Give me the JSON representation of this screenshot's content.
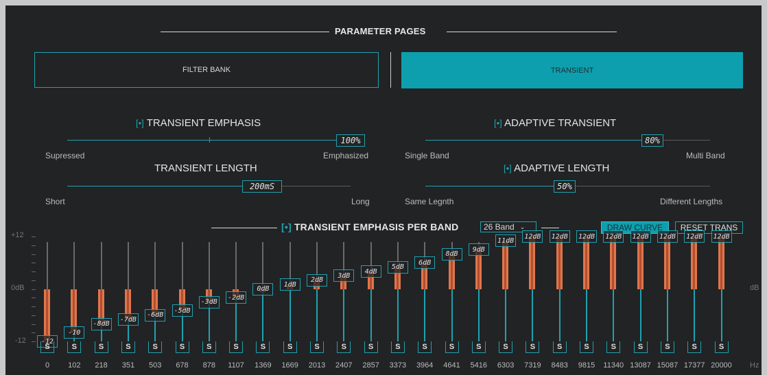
{
  "header": {
    "title": "PARAMETER PAGES"
  },
  "pages": {
    "filter_bank": "FILTER BANK",
    "transient": "TRANSIENT"
  },
  "transient_emphasis": {
    "toggle": "[•]",
    "title": "TRANSIENT EMPHASIS",
    "value": "100%",
    "level": 1.0,
    "min_label": "Supressed",
    "max_label": "Emphasized"
  },
  "transient_length": {
    "title": "TRANSIENT LENGTH",
    "value": "200mS",
    "level": 0.6,
    "min_label": "Short",
    "max_label": "Long"
  },
  "adaptive_transient": {
    "toggle": "[•]",
    "title": "ADAPTIVE TRANSIENT",
    "value": "80%",
    "level": 0.8,
    "min_label": "Single Band",
    "max_label": "Multi Band"
  },
  "adaptive_length": {
    "toggle": "[•]",
    "title": "ADAPTIVE LENGTH",
    "value": "50%",
    "level": 0.5,
    "min_label": "Same Legnth",
    "max_label": "Different Lengths"
  },
  "per_band": {
    "toggle": "[•]",
    "title": "TRANSIENT EMPHASIS PER BAND",
    "band_select": "26 Band",
    "draw_curve": "DRAW CURVE",
    "reset_trans": "RESET TRANS",
    "y_top": "+12",
    "y_mid": "0dB",
    "y_bottom": "-12",
    "unit_right": "dB",
    "hz": "Hz",
    "solo": "S",
    "bands": [
      {
        "freq": "0",
        "label": "-12",
        "db": -12
      },
      {
        "freq": "102",
        "label": "-10",
        "db": -10
      },
      {
        "freq": "218",
        "label": "-8dB",
        "db": -8
      },
      {
        "freq": "351",
        "label": "-7dB",
        "db": -7
      },
      {
        "freq": "503",
        "label": "-6dB",
        "db": -6
      },
      {
        "freq": "678",
        "label": "-5dB",
        "db": -5
      },
      {
        "freq": "878",
        "label": "-3dB",
        "db": -3
      },
      {
        "freq": "1107",
        "label": "-2dB",
        "db": -2
      },
      {
        "freq": "1369",
        "label": "0dB",
        "db": 0
      },
      {
        "freq": "1669",
        "label": "1dB",
        "db": 1
      },
      {
        "freq": "2013",
        "label": "2dB",
        "db": 2
      },
      {
        "freq": "2407",
        "label": "3dB",
        "db": 3
      },
      {
        "freq": "2857",
        "label": "4dB",
        "db": 4
      },
      {
        "freq": "3373",
        "label": "5dB",
        "db": 5
      },
      {
        "freq": "3964",
        "label": "6dB",
        "db": 6
      },
      {
        "freq": "4641",
        "label": "8dB",
        "db": 8
      },
      {
        "freq": "5416",
        "label": "9dB",
        "db": 9
      },
      {
        "freq": "6303",
        "label": "11dB",
        "db": 11
      },
      {
        "freq": "7319",
        "label": "12dB",
        "db": 12
      },
      {
        "freq": "8483",
        "label": "12dB",
        "db": 12
      },
      {
        "freq": "9815",
        "label": "12dB",
        "db": 12
      },
      {
        "freq": "11340",
        "label": "12dB",
        "db": 12
      },
      {
        "freq": "13087",
        "label": "12dB",
        "db": 12
      },
      {
        "freq": "15087",
        "label": "12dB",
        "db": 12
      },
      {
        "freq": "17377",
        "label": "12dB",
        "db": 12
      },
      {
        "freq": "20000",
        "label": "12dB",
        "db": 12
      }
    ]
  },
  "colors": {
    "accent": "#1fa2b2",
    "active_tab": "#0e9fae",
    "bar": "#e0764c",
    "background": "#222324"
  }
}
